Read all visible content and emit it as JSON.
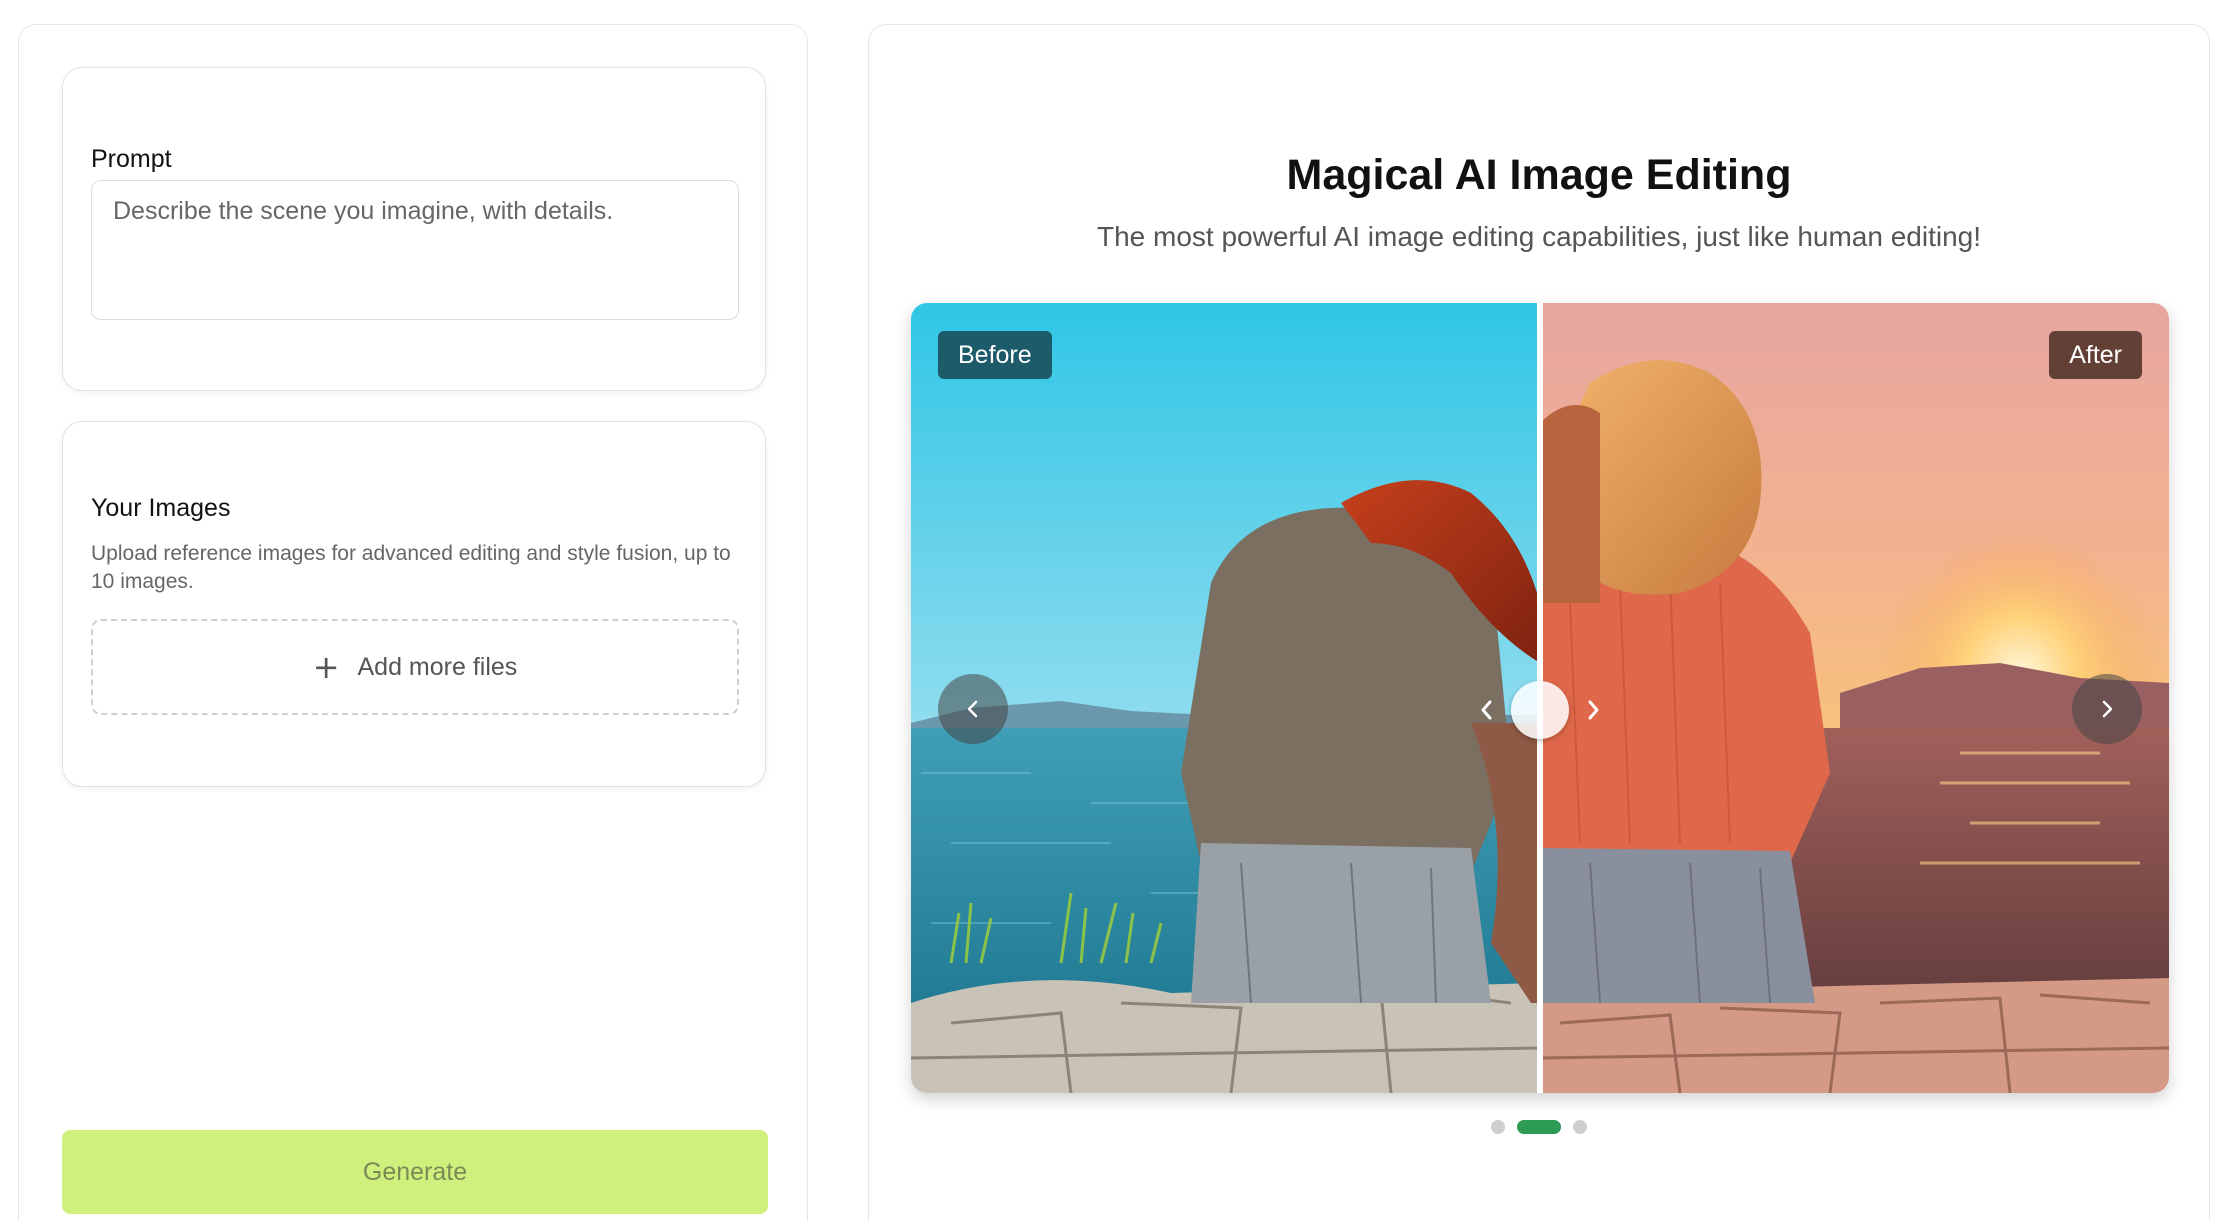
{
  "prompt": {
    "label": "Prompt",
    "placeholder": "Describe the scene you imagine, with details.",
    "value": ""
  },
  "images": {
    "label": "Your Images",
    "description": "Upload reference images for advanced editing and style fusion, up to 10 images.",
    "add_button": "Add more files",
    "add_icon": "plus-icon"
  },
  "generate": {
    "label": "Generate",
    "color": "#d0f07d"
  },
  "showcase": {
    "title": "Magical AI Image Editing",
    "subtitle": "The most powerful AI image editing capabilities, just like human editing!",
    "before_label": "Before",
    "after_label": "After",
    "prev_icon": "chevron-left-icon",
    "next_icon": "chevron-right-icon",
    "slide_count": 3,
    "active_slide": 2,
    "accent_color": "#2e9b55"
  }
}
